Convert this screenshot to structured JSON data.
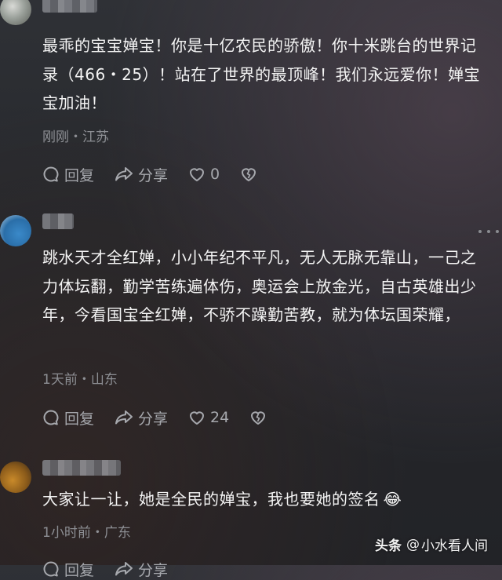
{
  "comments": [
    {
      "username": "",
      "content": "最乖的宝宝婵宝！你是十亿农民的骄傲！你十米跳台的世界记录（466・25）！站在了世界的最顶峰！我们永远爱你！婵宝宝加油！",
      "time": "刚刚",
      "location": "江苏",
      "reply_label": "回复",
      "share_label": "分享",
      "like_count": "0"
    },
    {
      "username": "",
      "content": "跳水天才全红婵，小小年纪不平凡，无人无脉无靠山，一己之力体坛翻，勤学苦练遍体伤，奥运会上放金光，自古英雄出少年，今看国宝全红婵，不骄不躁勤苦教，就为体坛国荣耀，",
      "time": "1天前",
      "location": "山东",
      "reply_label": "回复",
      "share_label": "分享",
      "like_count": "24"
    },
    {
      "username": "",
      "content": "大家让一让，她是全民的婵宝，我也要她的签名",
      "emoji": "😂",
      "time": "1小时前",
      "location": "广东",
      "reply_label": "回复",
      "share_label": "分享",
      "like_count": ""
    }
  ],
  "meta_separator": "・",
  "watermark": {
    "brand": "头条",
    "at": "@",
    "account": "小水看人间"
  },
  "colors": {
    "background": "#2a2c30",
    "text": "#f4f4f4",
    "meta": "#8d8f94",
    "action": "#a6a8ad"
  },
  "icons": [
    "more-icon",
    "reply-icon",
    "share-icon",
    "like-icon",
    "dislike-icon"
  ]
}
